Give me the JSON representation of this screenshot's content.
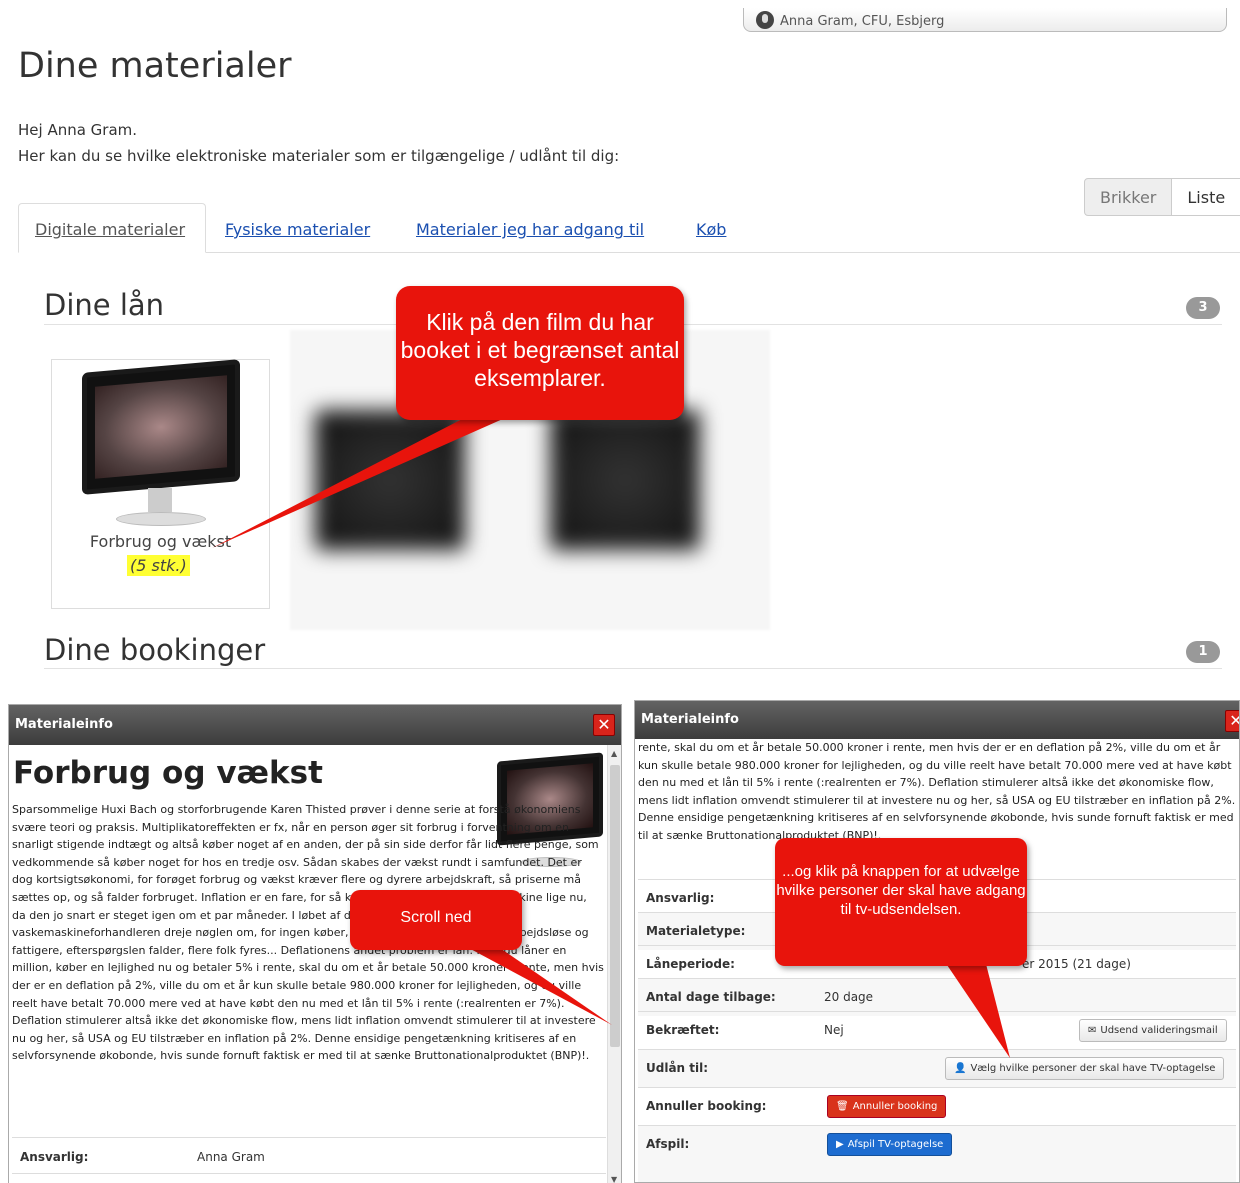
{
  "header": {
    "user": "Anna Gram, CFU, Esbjerg"
  },
  "page_title": "Dine materialer",
  "greeting": {
    "line1": "Hej Anna Gram.",
    "line2": "Her kan du se hvilke elektroniske materialer som er tilgængelige / udlånt til dig:"
  },
  "view_toggle": {
    "brikker": "Brikker",
    "liste": "Liste"
  },
  "tabs": [
    {
      "label": "Digitale materialer"
    },
    {
      "label": "Fysiske materialer"
    },
    {
      "label": "Materialer jeg har adgang til"
    },
    {
      "label": "Køb"
    }
  ],
  "loans": {
    "heading": "Dine lån",
    "count": "3",
    "item_title": "Forbrug og vækst",
    "item_count": "(5 stk.)"
  },
  "bookings": {
    "heading": "Dine bookinger",
    "count": "1"
  },
  "callouts": {
    "c1": "Klik på den film du har booket i et begrænset antal eksemplarer.",
    "c2": "Scroll ned",
    "c3": "...og klik på knappen for at udvælge hvilke personer der skal have adgang til tv-udsendelsen."
  },
  "panel_left": {
    "header": "Materialeinfo",
    "title": "Forbrug og vækst",
    "description": "Sparsommelige Huxi Bach og storforbrugende Karen Thisted prøver i denne serie at forstå økonomiens svære teori og praksis. Multiplikatoreffekten er fx, når en person øger sit forbrug i forventning om en snarligt stigende indtægt og altså køber noget af en anden, der på sin side derfor får lidt flere penge, som vedkommende så køber noget for hos en tredje osv. Sådan skabes der vækst rundt i samfundet. Det er dog kortsigtsøkonomi, for forøget forbrug og vækst kræver flere og dyrere arbejdskraft, så priserne må sættes op, og så falder forbruget. Inflation er en fare, for så køber man fx ikke en vaskemaskine lige nu, da den jo snart er steget igen om et par måneder. I løbet af de par måneder må vaskemaskineforhandleren dreje nøglen om, for ingen køber, så der fyres folk, som bliver arbejdsløse og fattigere, efterspørgslen falder, flere folk fyres... Deflationens andet problem er lån: Hvis du låner en million, køber en lejlighed nu og betaler 5% i rente, skal du om et år betale 50.000 kroner i rente, men hvis der er en deflation på 2%, ville du om et år kun skulle betale 980.000 kroner for lejligheden, og du ville reelt have betalt 70.000 mere ved at have købt den nu med et lån til 5% i rente (:realrenten er 7%). Deflation stimulerer altså ikke det økonomiske flow, mens lidt inflation omvendt stimulerer til at investere nu og her, så USA og EU tilstræber en inflation på 2%. Denne ensidige pengetænkning kritiseres af en selvforsynende økobonde, hvis sunde fornuft faktisk er med til at sænke Bruttonationalproduktet (BNP)!.",
    "rows": [
      {
        "key": "Ansvarlig:",
        "value": "Anna Gram"
      }
    ]
  },
  "panel_right": {
    "header": "Materialeinfo",
    "description": "rente, skal du om et år betale 50.000 kroner i rente, men hvis der er en deflation på 2%, ville du om et år kun skulle betale 980.000 kroner for lejligheden, og du ville reelt have betalt 70.000 mere ved at have købt den nu med et lån til 5% i rente (:realrenten er 7%). Deflation stimulerer altså ikke det økonomiske flow, mens lidt inflation omvendt stimulerer til at investere nu og her, så USA og EU tilstræber en inflation på 2%. Denne ensidige pengetænkning kritiseres af en selvforsynende økobonde, hvis sunde fornuft faktisk er med til at sænke Bruttonationalproduktet (BNP)!.",
    "rows": {
      "ansvarlig": "Ansvarlig:",
      "materialetype": "Materialetype:",
      "laaneperiode": "Låneperiode:",
      "laaneperiode_value": "er 2015 (21 dage)",
      "dage_tilbage": "Antal dage tilbage:",
      "dage_tilbage_value": "20 dage",
      "bekraeftet": "Bekræftet:",
      "bekraeftet_value": "Nej",
      "udlaan": "Udlån til:",
      "annuller": "Annuller booking:",
      "afspil": "Afspil:"
    },
    "buttons": {
      "validering": "Udsend valideringsmail",
      "vaelg": "Vælg hvilke personer der skal have TV-optagelse",
      "annuller": "Annuller booking",
      "afspil": "Afspil TV-optagelse"
    }
  }
}
